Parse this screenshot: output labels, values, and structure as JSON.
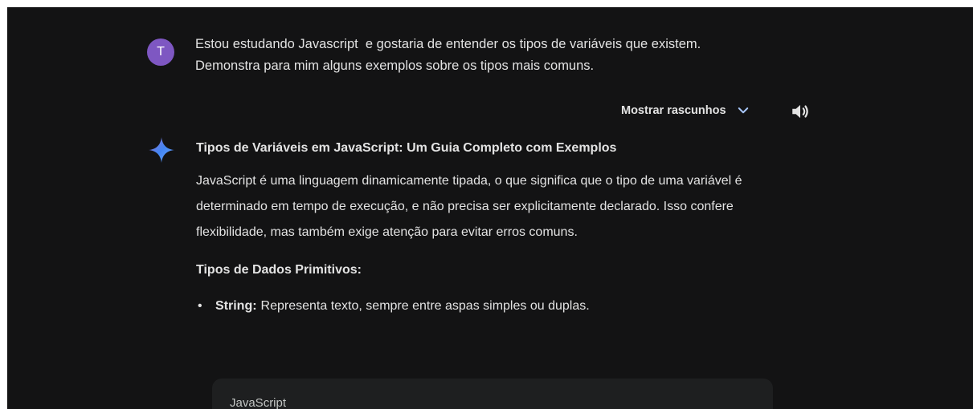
{
  "user_message": {
    "avatar_letter": "T",
    "avatar_color": "#7e57c2",
    "text": "Estou estudando Javascript  e gostaria de entender os tipos de variáveis que existem. Demonstra para mim alguns exemplos sobre os tipos mais comuns."
  },
  "toolbar": {
    "drafts_label": "Mostrar rascunhos"
  },
  "response": {
    "title": "Tipos de Variáveis em JavaScript: Um Guia Completo com Exemplos",
    "intro": "JavaScript é uma linguagem dinamicamente tipada, o que significa que o tipo de uma variável é determinado em tempo de execução, e não precisa ser explicitamente declarado. Isso confere flexibilidade, mas também exige atenção para evitar erros comuns.",
    "section_title": "Tipos de Dados Primitivos:",
    "bullets": [
      {
        "term": "String:",
        "text": "Representa texto, sempre entre aspas simples ou duplas."
      }
    ],
    "code_block": {
      "language": "JavaScript"
    }
  },
  "colors": {
    "background": "#131314",
    "text": "#e3e3e3",
    "code_bg": "#1e1f20"
  }
}
